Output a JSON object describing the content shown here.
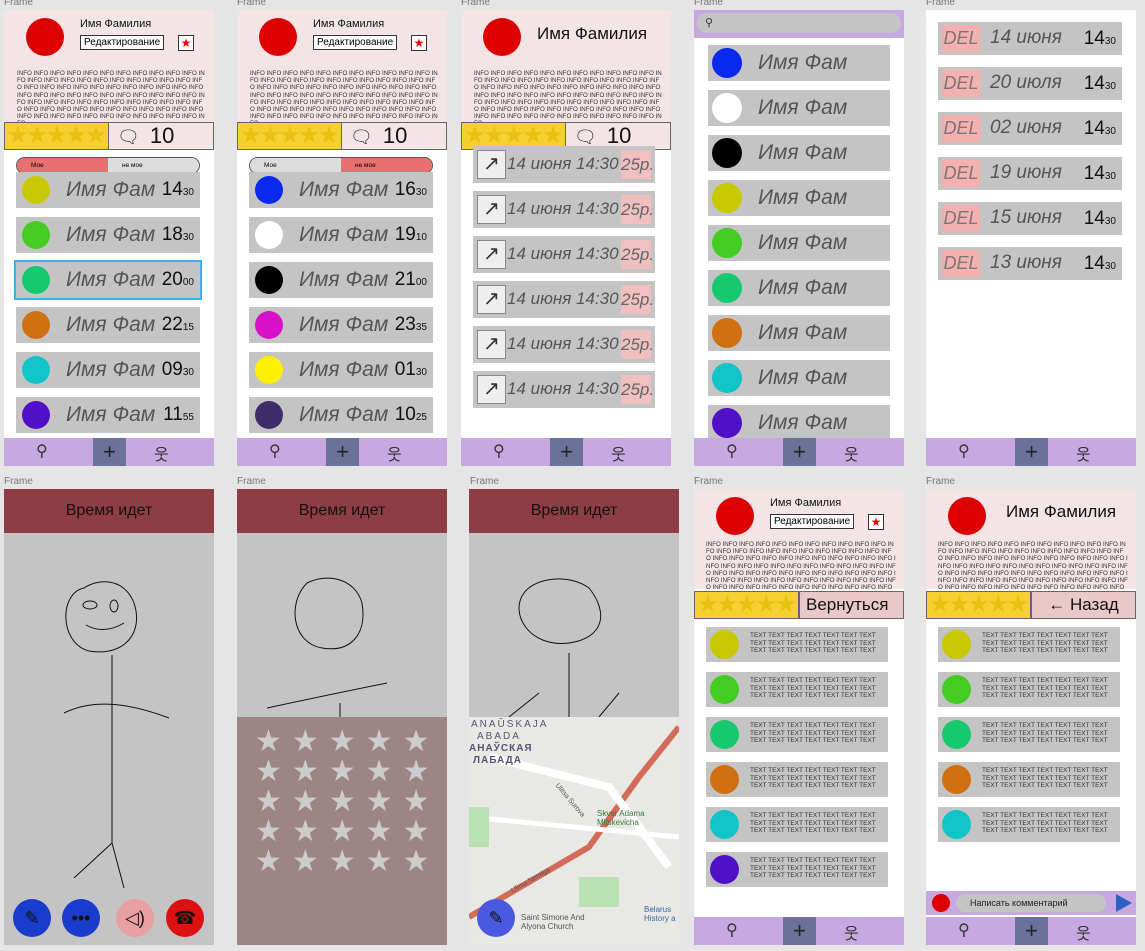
{
  "frame_label": "Frame",
  "profile": {
    "name": "Имя Фамилия",
    "edit": "Редактирование",
    "info": "INFO INFO INFO INFO INFO INFO INFO INFO INFO INFO INFO INFO INFO INFO INFO INFO INFO INFO INFO INFO INFO INFO INFO INFO INFO INFO INFO INFO INFO INFO INFO INFO INFO INFO INFO INFO INFO INFO INFO INFO INFO INFO INFO INFO INFO INFO INFO INFO INFO INFO INFO INFO INFO INFO INFO INFO INFO INFO INFO INFO INFO INFO INFO INFO INFO INFO INFO INFO INFO INFO INFO INFO INFO INFO INFO INFO INFO INFO INFO INFO",
    "stars": "★★★★★",
    "rating_value": 5,
    "comments": "10"
  },
  "toggle": {
    "mine": "Мое",
    "not_mine": "не мое"
  },
  "list1": [
    {
      "name": "Имя Фам",
      "hh": "14",
      "mm": "30",
      "color": "#c8c800"
    },
    {
      "name": "Имя Фам",
      "hh": "18",
      "mm": "30",
      "color": "#44cc22"
    },
    {
      "name": "Имя Фам",
      "hh": "20",
      "mm": "00",
      "color": "#16c86e"
    },
    {
      "name": "Имя Фам",
      "hh": "22",
      "mm": "15",
      "color": "#d07010"
    },
    {
      "name": "Имя Фам",
      "hh": "09",
      "mm": "30",
      "color": "#10c4c8"
    },
    {
      "name": "Имя Фам",
      "hh": "11",
      "mm": "55",
      "color": "#5010c8"
    }
  ],
  "list2": [
    {
      "name": "Имя Фам",
      "hh": "16",
      "mm": "30",
      "color": "#0a28f0"
    },
    {
      "name": "Имя Фам",
      "hh": "19",
      "mm": "10",
      "color": "#ffffff"
    },
    {
      "name": "Имя Фам",
      "hh": "21",
      "mm": "00",
      "color": "#000000"
    },
    {
      "name": "Имя Фам",
      "hh": "23",
      "mm": "35",
      "color": "#d810c8"
    },
    {
      "name": "Имя Фам",
      "hh": "01",
      "mm": "30",
      "color": "#fff000"
    },
    {
      "name": "Имя Фам",
      "hh": "10",
      "mm": "25",
      "color": "#3e2c6a"
    }
  ],
  "tasks": [
    {
      "date": "14 июня 14:30",
      "price": "25р."
    },
    {
      "date": "14 июня 14:30",
      "price": "25р."
    },
    {
      "date": "14 июня 14:30",
      "price": "25р."
    },
    {
      "date": "14 июня 14:30",
      "price": "25р."
    },
    {
      "date": "14 июня 14:30",
      "price": "25р."
    },
    {
      "date": "14 июня 14:30",
      "price": "25р."
    }
  ],
  "search_list": [
    {
      "name": "Имя Фам",
      "color": "#0a28f0"
    },
    {
      "name": "Имя Фам",
      "color": "#ffffff"
    },
    {
      "name": "Имя Фам",
      "color": "#000000"
    },
    {
      "name": "Имя Фам",
      "color": "#c8c800"
    },
    {
      "name": "Имя Фам",
      "color": "#44cc22"
    },
    {
      "name": "Имя Фам",
      "color": "#16c86e"
    },
    {
      "name": "Имя Фам",
      "color": "#d07010"
    },
    {
      "name": "Имя Фам",
      "color": "#10c4c8"
    },
    {
      "name": "Имя Фам",
      "color": "#5010c8"
    }
  ],
  "schedule": [
    {
      "del": "DEL",
      "date": "14 июня",
      "hh": "14",
      "mm": "30"
    },
    {
      "del": "DEL",
      "date": "20 июля",
      "hh": "14",
      "mm": "30"
    },
    {
      "del": "DEL",
      "date": "02 июня",
      "hh": "14",
      "mm": "30"
    },
    {
      "del": "DEL",
      "date": "19 июня",
      "hh": "14",
      "mm": "30"
    },
    {
      "del": "DEL",
      "date": "15 июня",
      "hh": "14",
      "mm": "30"
    },
    {
      "del": "DEL",
      "date": "13 июня",
      "hh": "14",
      "mm": "30"
    }
  ],
  "game": {
    "title": "Время идет",
    "stars": "★★★★★"
  },
  "map_labels": {
    "l1": "ANAŬSKAJA",
    "l2": "ABADA",
    "l3": "АНАЎСКАЯ",
    "l4": "ЛАБАДА",
    "l5": "Skver Adama Mitskevicha",
    "l6": "Saint Simone And Alyona Church",
    "l7": "Belarus History a",
    "l8": "Ulitsa Nemiga",
    "l9": "Ulitsa Surova"
  },
  "reviews": {
    "back_ru": "Вернуться",
    "back2": "← Назад",
    "text": "TEXT TEXT TEXT TEXT TEXT TEXT TEXT TEXT TEXT TEXT TEXT TEXT TEXT TEXT TEXT TEXT TEXT TEXT TEXT TEXT TEXT"
  },
  "review_colors1": [
    "#c8c800",
    "#44cc22",
    "#16c86e",
    "#d07010",
    "#10c4c8",
    "#5010c8"
  ],
  "review_colors2": [
    "#c8c800",
    "#44cc22",
    "#16c86e",
    "#d07010",
    "#10c4c8"
  ],
  "comment_placeholder": "Написать комментарий",
  "icons": {
    "search": "search-icon",
    "plus": "plus-icon",
    "profile": "person-icon",
    "comment": "comment-icon",
    "send": "send-icon",
    "draw": "pencil-icon",
    "chat": "chat-icon",
    "sound": "speaker-icon",
    "hangup": "hangup-icon",
    "arrow": "draw-arrow-icon",
    "star": "star-icon"
  }
}
